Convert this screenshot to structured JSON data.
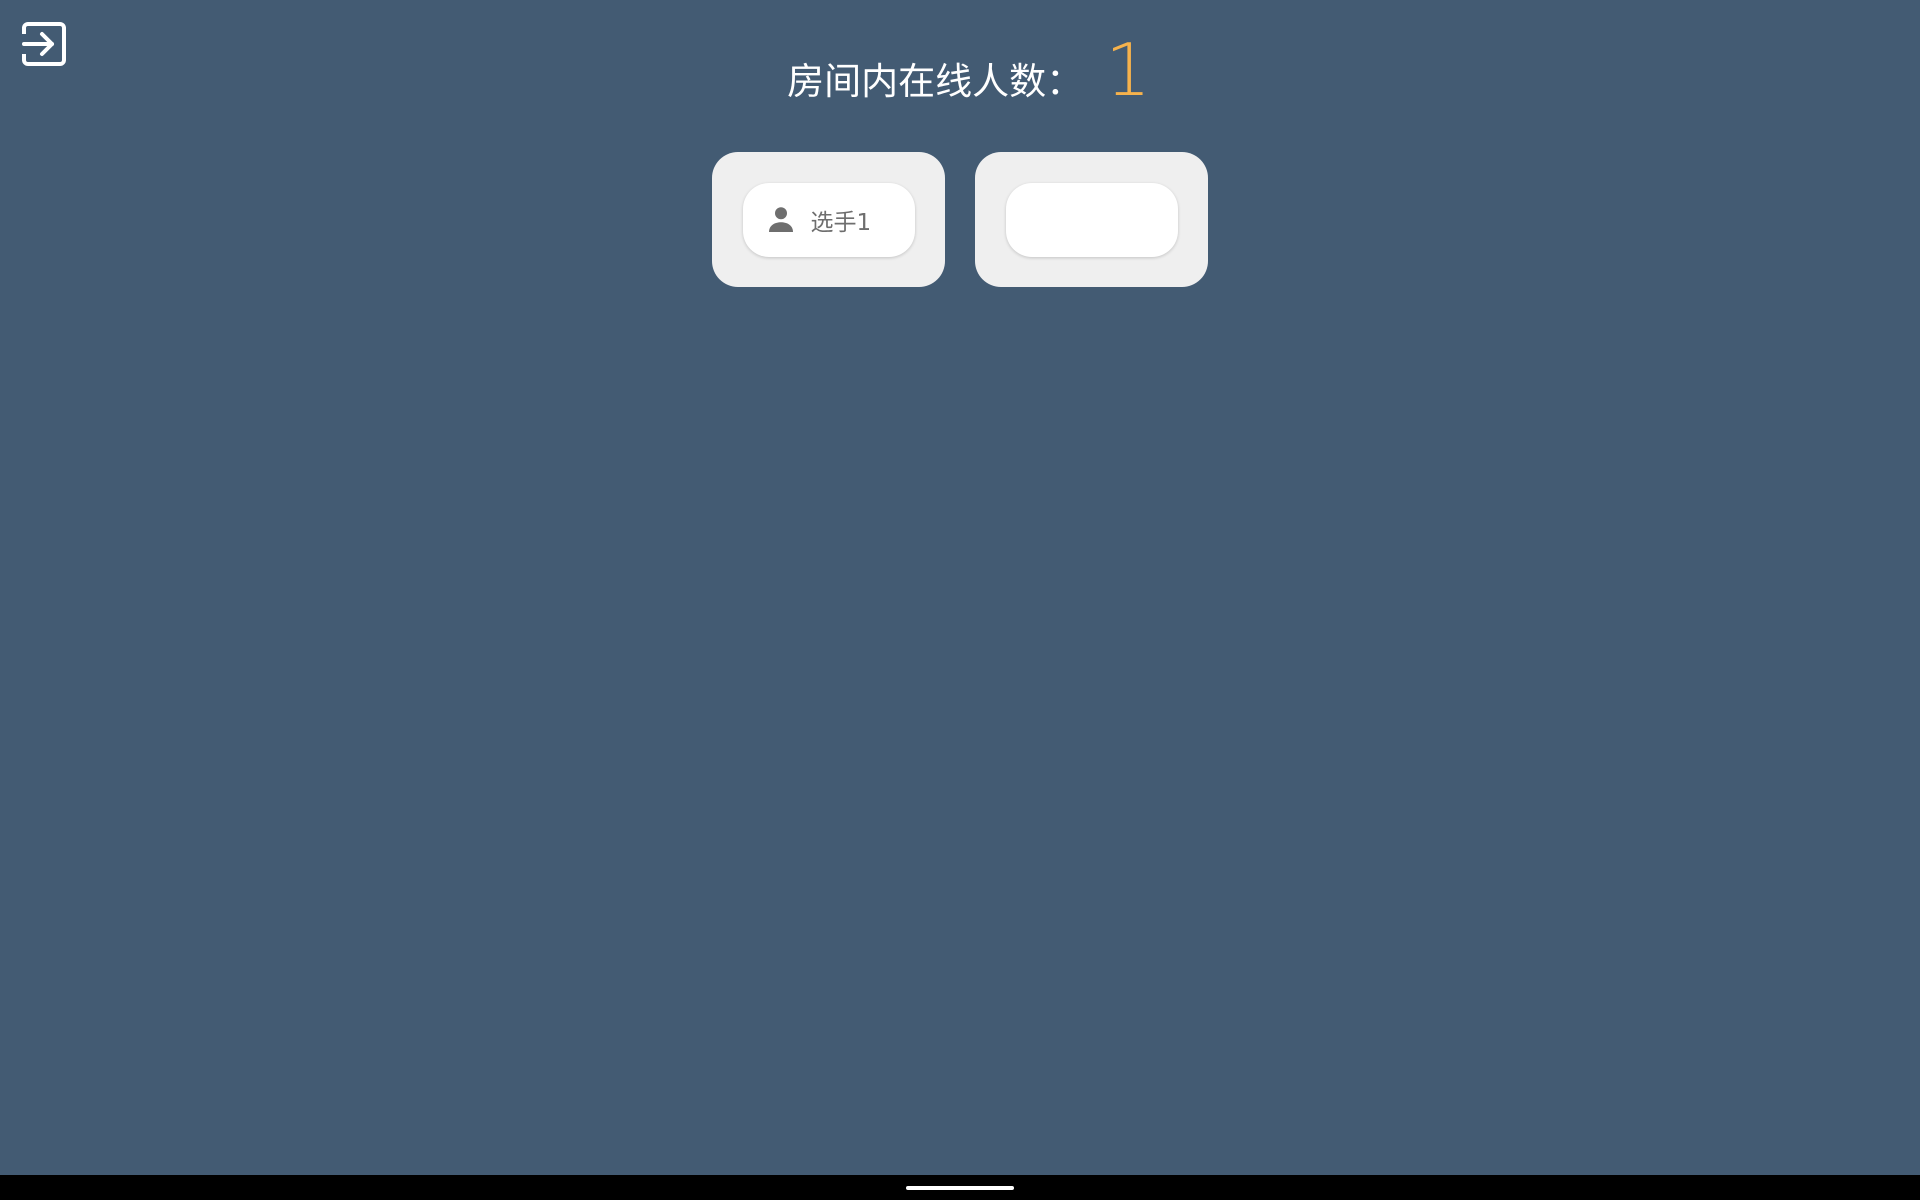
{
  "header": {
    "exit_icon": "exit-to-app-icon",
    "online_label": "房间内在线人数：",
    "online_count": "1"
  },
  "slots": [
    {
      "player_name": "选手1",
      "icon": "person-icon",
      "occupied": true
    },
    {
      "player_name": "",
      "occupied": false
    }
  ],
  "colors": {
    "background": "#435b73",
    "accent": "#f6b24c",
    "slot_bg": "#efefef",
    "card_bg": "#ffffff",
    "text_muted": "#6e6e6e"
  }
}
